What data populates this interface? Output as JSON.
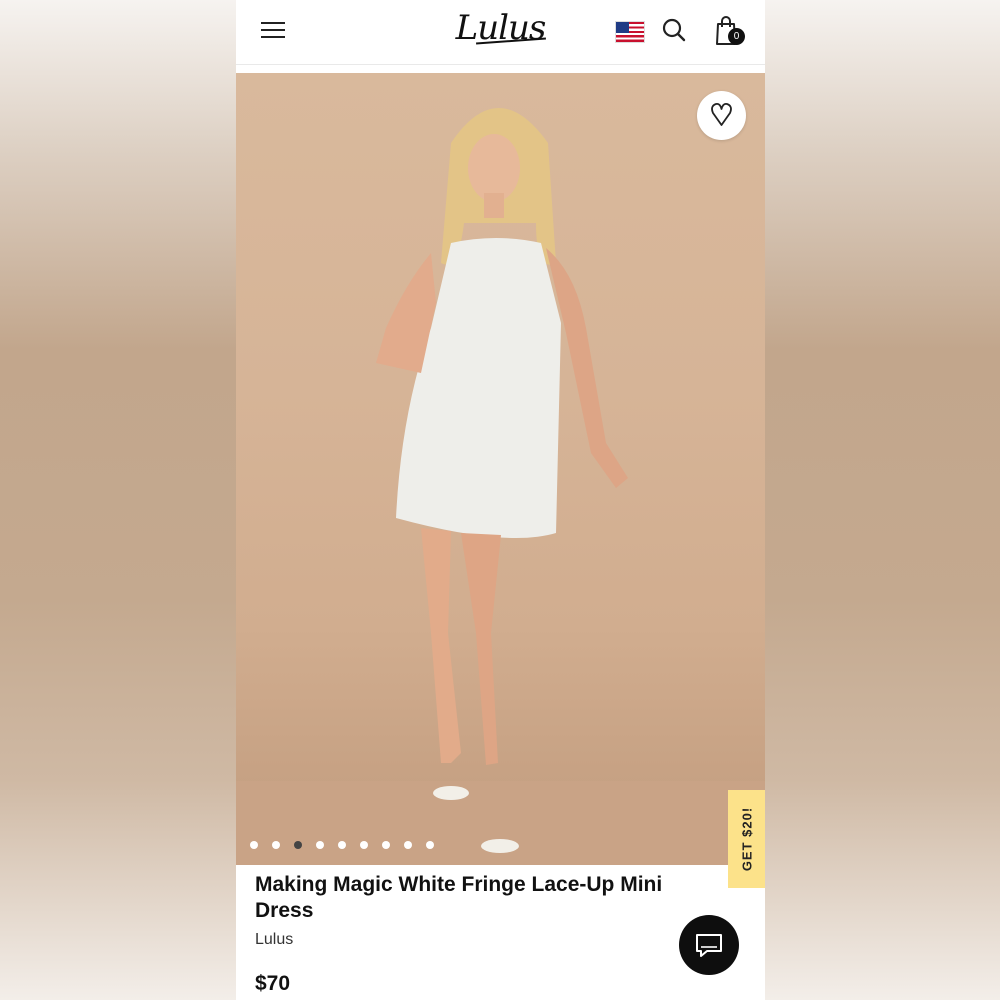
{
  "header": {
    "logo": "Lulus",
    "menu_icon": "hamburger-menu-icon",
    "flag_icon": "us-flag-icon",
    "search_icon": "search-icon",
    "bag_icon": "shopping-bag-icon",
    "bag_count": "0"
  },
  "gallery": {
    "favorite_icon": "heart-icon",
    "image_count": 9,
    "active_index": 2,
    "promo_label": "GET $20!"
  },
  "product": {
    "title": "Making Magic White Fringe Lace-Up Mini Dress",
    "brand": "Lulus",
    "price": "$70"
  },
  "chat": {
    "icon": "chat-bubble-icon"
  },
  "colors": {
    "promo": "#fce28a",
    "backdrop": "#d6b497",
    "chat_button": "#0e0e0e"
  }
}
